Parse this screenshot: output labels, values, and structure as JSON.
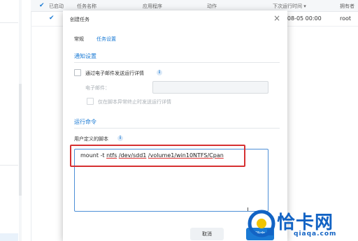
{
  "table": {
    "headers": {
      "enabled": "已启动",
      "task_name": "任务名称",
      "application": "应用程序",
      "action": "动作",
      "next_run": "下次运行时间 ▾",
      "owner": "拥有者"
    },
    "row": {
      "next_run": "-08-05 00:00",
      "owner": "root"
    }
  },
  "dialog": {
    "title": "创建任务",
    "close": "×",
    "tabs": [
      "常规",
      "任务设置"
    ],
    "notify": {
      "section_title": "通知设置",
      "send_email_label": "通过电子邮件发送运行详情",
      "email_label": "电子邮件：",
      "email_value": "",
      "only_on_error_label": "仅在脚本异常终止时发送运行详情"
    },
    "run": {
      "section_title": "运行命令",
      "script_label": "用户定义的脚本",
      "script_parts": [
        "mount -t ",
        "ntfs",
        " ",
        "/dev/sdd1",
        " ",
        "/volume1/win10NTFS/Cpan"
      ]
    },
    "buttons": {
      "cancel": "取消",
      "ok": "确定"
    }
  },
  "watermark": {
    "text": "恰卡网",
    "sub": "qiaqa.com",
    "color": "#1263c4"
  },
  "colors": {
    "accent": "#1a7ad4",
    "highlight_box": "#d63031"
  }
}
